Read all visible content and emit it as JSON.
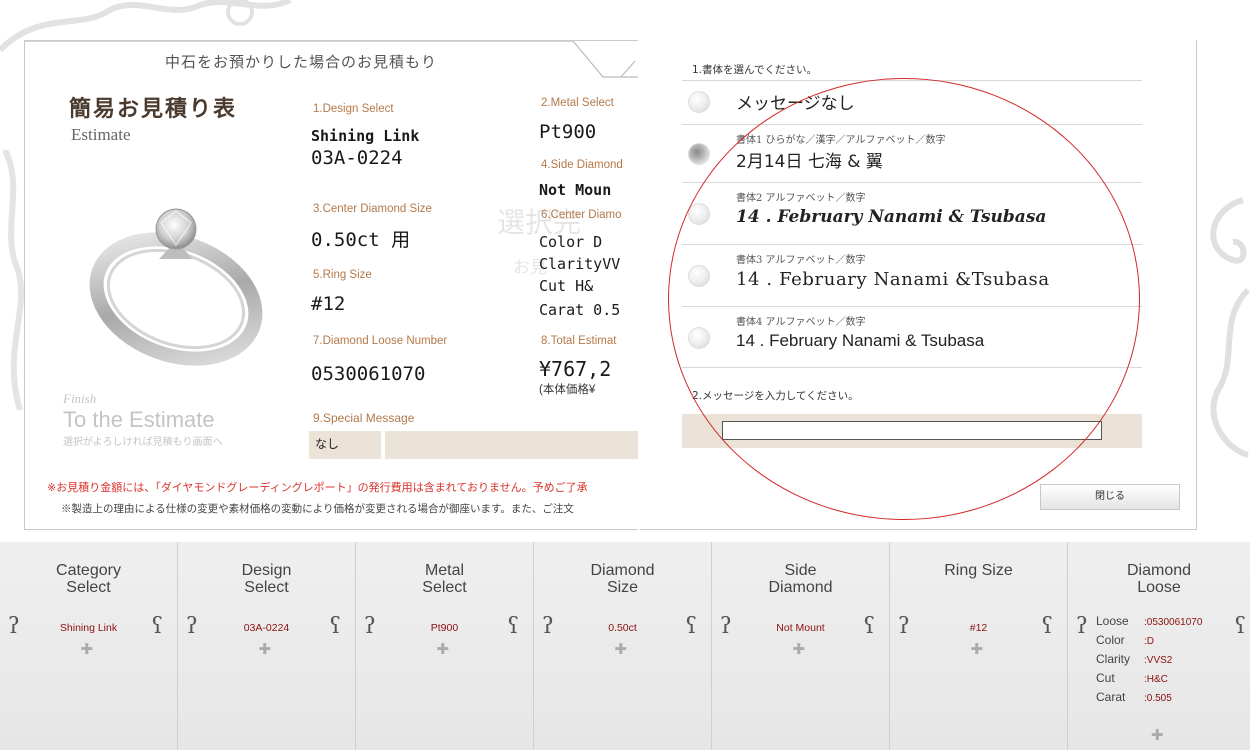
{
  "estimate": {
    "tab_title": "中石をお預かりした場合のお見積もり",
    "title_jp": "簡易お見積り表",
    "title_en": "Estimate",
    "fields": {
      "design_label": "1.Design Select",
      "design_value_1": "Shining Link",
      "design_value_2": "03A-0224",
      "metal_label": "2.Metal Select",
      "metal_value": "Pt900",
      "center_size_label": "3.Center Diamond Size",
      "center_size_value": "0.50ct 用",
      "side_label": "4.Side Diamond",
      "side_value": "Not Moun",
      "ring_size_label": "5.Ring Size",
      "ring_size_value": "#12",
      "center_diamond_label": "6.Center Diamo",
      "color_line": "Color D",
      "clarity_line": "ClarityVV",
      "cut_line": "Cut   H&",
      "carat_line": "Carat 0.5",
      "loose_label": "7.Diamond Loose Number",
      "loose_value": "0530061070",
      "total_label": "8.Total Estimat",
      "total_value": "¥767,2",
      "total_note": "(本体価格¥",
      "message_label": "9.Special Message",
      "message_value": "なし"
    },
    "finish_small": "Finish",
    "finish_big": "To the Estimate",
    "finish_note": "選択がよろしければ見積もり画面へ",
    "watermark": "選択完",
    "watermark2": "お見",
    "warning": "※お見積り金額には、「ダイヤモンドグレーディングレポート」の発行費用は含まれておりません。予めご了承",
    "note": "※製造上の理由による仕様の変更や素材価格の変動により価格が変更される場合が御座います。また、ご注文"
  },
  "script_panel": {
    "question_1": "1.書体を選んでください。",
    "options": [
      {
        "label": "",
        "text": "メッセージなし"
      },
      {
        "label": "書体1  ひらがな／漢字／アルファベット／数字",
        "text": "2月14日 七海 & 翼"
      },
      {
        "label": "書体2  アルファベット／数字",
        "text": "14 . February Nanami & Tsubasa"
      },
      {
        "label": "書体3  アルファベット／数字",
        "text": "14 . February Nanami &Tsubasa"
      },
      {
        "label": "書体4  アルファベット／数字",
        "text": "14 . February Nanami & Tsubasa"
      }
    ],
    "selected_index": 1,
    "question_2": "2.メッセージを入力してください。",
    "message_input_value": "",
    "close_label": "閉じる"
  },
  "bottom_bar": {
    "columns": [
      {
        "title_1": "Category",
        "title_2": "Select",
        "value": "Shining Link"
      },
      {
        "title_1": "Design",
        "title_2": "Select",
        "value": "03A-0224"
      },
      {
        "title_1": "Metal",
        "title_2": "Select",
        "value": "Pt900"
      },
      {
        "title_1": "Diamond",
        "title_2": "Size",
        "value": "0.50ct"
      },
      {
        "title_1": "Side",
        "title_2": "Diamond",
        "value": "Not Mount"
      },
      {
        "title_1": "Ring Size",
        "title_2": "",
        "value": "#12"
      },
      {
        "title_1": "Diamond",
        "title_2": "Loose",
        "value": ""
      }
    ],
    "loose": {
      "loose_key": "Loose",
      "loose_val": ":0530061070",
      "color_key": "Color",
      "color_val": ":D",
      "clarity_key": "Clarity",
      "clarity_val": ":VVS2",
      "cut_key": "Cut",
      "cut_val": ":H&C",
      "carat_key": "Carat",
      "carat_val": ":0.505"
    }
  },
  "icons": {
    "left_arrow": "left-scroll-arrow-icon",
    "right_arrow": "right-scroll-arrow-icon",
    "plus": "plus-icon"
  },
  "colors": {
    "accent_label": "#b5794a",
    "warning_red": "#d8322b",
    "value_red": "#8a1010",
    "annotation_circle": "#d42828"
  }
}
